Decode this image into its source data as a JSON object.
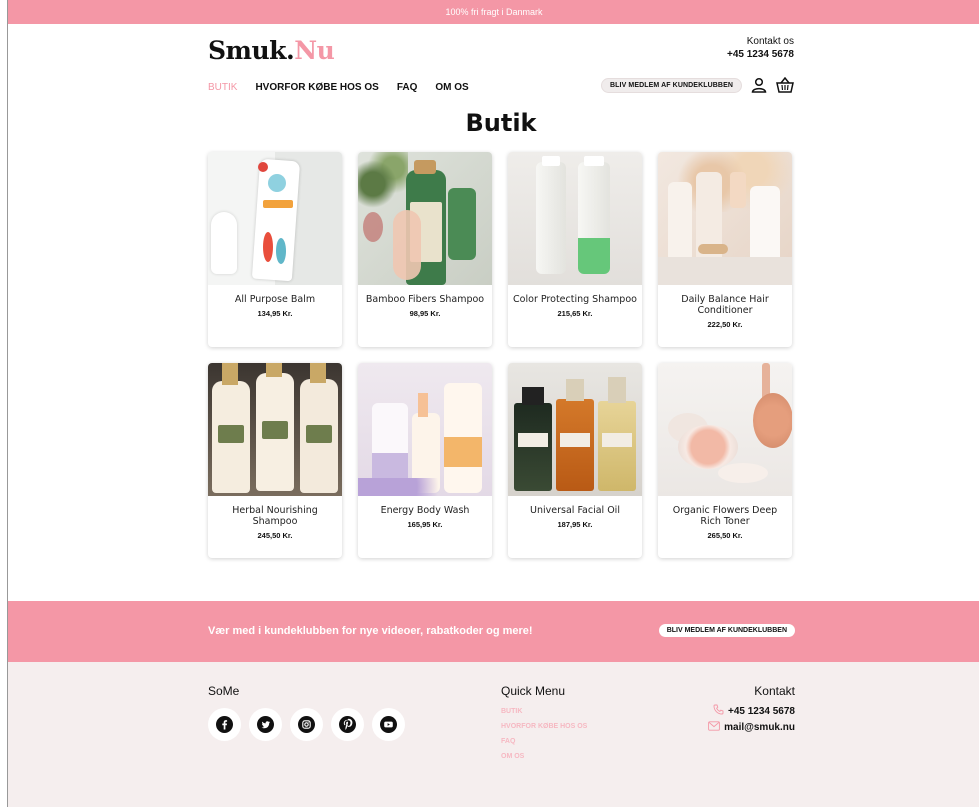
{
  "topbar": {
    "text": "100% fri fragt i Danmark"
  },
  "header": {
    "logo_main": "Smuk.",
    "logo_accent": "Nu",
    "contact_label": "Kontakt os",
    "contact_phone": "+45 1234 5678",
    "nav": [
      "BUTIK",
      "HVORFOR KØBE HOS OS",
      "FAQ",
      "OM OS"
    ],
    "member_button": "BLIV MEDLEM AF KUNDEKLUBBEN",
    "icons": [
      "user-icon",
      "basket-icon"
    ]
  },
  "main": {
    "title": "Butik",
    "products": [
      {
        "name": "All Purpose Balm",
        "price": "134,95 Kr."
      },
      {
        "name": "Bamboo Fibers Shampoo",
        "price": "98,95 Kr."
      },
      {
        "name": "Color Protecting Shampoo",
        "price": "215,65 Kr."
      },
      {
        "name": "Daily Balance Hair Conditioner",
        "price": "222,50 Kr."
      },
      {
        "name": "Herbal Nourishing Shampoo",
        "price": "245,50 Kr."
      },
      {
        "name": "Energy Body Wash",
        "price": "165,95 Kr."
      },
      {
        "name": "Universal Facial Oil",
        "price": "187,95 Kr."
      },
      {
        "name": "Organic Flowers Deep Rich Toner",
        "price": "265,50 Kr."
      }
    ]
  },
  "banner": {
    "text": "Vær med i kundeklubben for nye videoer, rabatkoder og mere!",
    "button": "BLIV MEDLEM AF KUNDEKLUBBEN"
  },
  "footer": {
    "some_title": "SoMe",
    "social_icons": [
      "facebook-icon",
      "twitter-icon",
      "instagram-icon",
      "pinterest-icon",
      "youtube-icon"
    ],
    "quick_title": "Quick Menu",
    "quick_links": [
      "BUTIK",
      "HVORFOR KØBE HOS OS",
      "FAQ",
      "OM OS"
    ],
    "contact_title": "Kontakt",
    "phone": "+45 1234 5678",
    "email": "mail@smuk.nu"
  },
  "colors": {
    "accent": "#f497a6",
    "footer_bg": "#f5eeee",
    "link_light": "#f6b8c2"
  }
}
